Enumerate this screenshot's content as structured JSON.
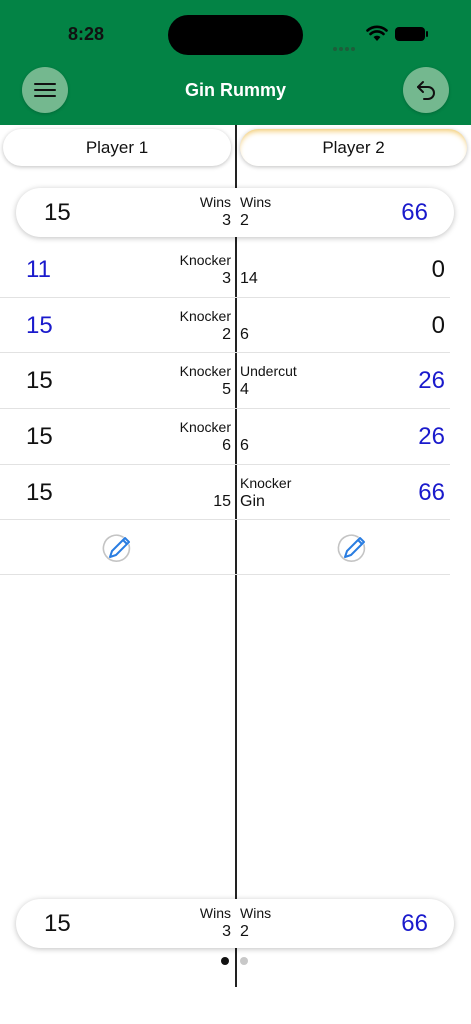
{
  "status": {
    "time": "8:28"
  },
  "header": {
    "title": "Gin Rummy"
  },
  "players": [
    "Player 1",
    "Player 2"
  ],
  "summary": {
    "left_score": "15",
    "left_label": "Wins",
    "left_value": "3",
    "right_label": "Wins",
    "right_value": "2",
    "right_score": "66"
  },
  "rounds": [
    {
      "left_score": "11",
      "left_label": "Knocker",
      "left_value": "3",
      "right_label": "",
      "right_value": "14",
      "right_score": "0"
    },
    {
      "left_score": "15",
      "left_label": "Knocker",
      "left_value": "2",
      "right_label": "",
      "right_value": "6",
      "right_score": "0"
    },
    {
      "left_score": "15",
      "left_label": "Knocker",
      "left_value": "5",
      "right_label": "Undercut",
      "right_value": "4",
      "right_score": "26"
    },
    {
      "left_score": "15",
      "left_label": "Knocker",
      "left_value": "6",
      "right_label": "",
      "right_value": "6",
      "right_score": "26"
    },
    {
      "left_score": "15",
      "left_label": "",
      "left_value": "15",
      "right_label": "Knocker",
      "right_value": "Gin",
      "right_score": "66"
    }
  ],
  "footer": {
    "left_score": "15",
    "left_label": "Wins",
    "left_value": "3",
    "right_label": "Wins",
    "right_value": "2",
    "right_score": "66"
  },
  "colors": {
    "header_bg": "#038345",
    "button_bg": "#74b88f",
    "score_blue": "#1a1acc",
    "active_glow": "#f2c96b"
  },
  "icons": [
    "menu-icon",
    "undo-icon",
    "edit-icon",
    "wifi-icon",
    "battery-icon"
  ],
  "pager": {
    "pages": 2,
    "current": 1
  }
}
